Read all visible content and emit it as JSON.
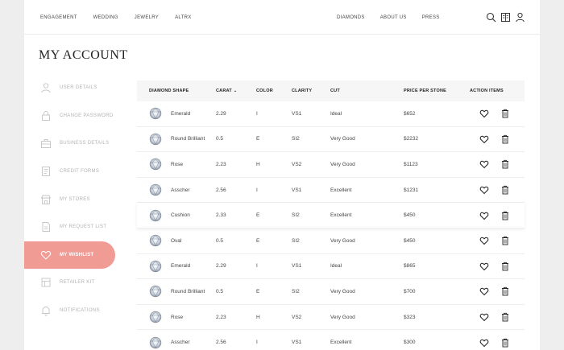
{
  "nav": {
    "left": [
      "ENGAGEMENT",
      "WEDDING",
      "JEWELRY",
      "ALTRX"
    ],
    "right": [
      "DIAMONDS",
      "ABOUT US",
      "PRESS"
    ],
    "icons": [
      "search-icon",
      "catalog-icon",
      "user-icon"
    ]
  },
  "page_title": "MY ACCOUNT",
  "sidebar": {
    "items": [
      {
        "label": "USER DETAILS",
        "icon": "user-icon"
      },
      {
        "label": "CHANGE PASSWORD",
        "icon": "lock-icon"
      },
      {
        "label": "BUSINESS DETAILS",
        "icon": "briefcase-icon"
      },
      {
        "label": "CREDIT FORMS",
        "icon": "form-icon"
      },
      {
        "label": "MY STORES",
        "icon": "store-icon"
      },
      {
        "label": "MY REQUEST LIST",
        "icon": "list-icon"
      },
      {
        "label": "MY WISHLIST",
        "icon": "heart-icon",
        "active": true
      },
      {
        "label": "RETAILER KIT",
        "icon": "kit-icon"
      },
      {
        "label": "NOTIFICATIONS",
        "icon": "bell-icon"
      }
    ]
  },
  "table": {
    "headers": {
      "shape": "DIAMOND SHAPE",
      "carat": "CARAT",
      "color": "COLOR",
      "clarity": "CLARITY",
      "cut": "CUT",
      "price": "PRICE PER STONE",
      "actions": "ACTION ITEMS"
    },
    "sort_indicator": "⌄",
    "rows": [
      {
        "shape": "Emerald",
        "carat": "2.29",
        "color": "I",
        "clarity": "VS1",
        "cut": "Ideal",
        "price": "$652"
      },
      {
        "shape": "Round Brilliant",
        "carat": "0.5",
        "color": "E",
        "clarity": "SI2",
        "cut": "Very Good",
        "price": "$2232"
      },
      {
        "shape": "Rose",
        "carat": "2.23",
        "color": "H",
        "clarity": "VS2",
        "cut": "Very Good",
        "price": "$1123"
      },
      {
        "shape": "Asscher",
        "carat": "2.56",
        "color": "I",
        "clarity": "VS1",
        "cut": "Excellent",
        "price": "$1231"
      },
      {
        "shape": "Cushion",
        "carat": "2.33",
        "color": "E",
        "clarity": "SI2",
        "cut": "Excellent",
        "price": "$450"
      },
      {
        "shape": "Oval",
        "carat": "0.5",
        "color": "E",
        "clarity": "SI2",
        "cut": "Very Good",
        "price": "$450"
      },
      {
        "shape": "Emerald",
        "carat": "2.29",
        "color": "I",
        "clarity": "VS1",
        "cut": "Ideal",
        "price": "$865"
      },
      {
        "shape": "Round Brilliant",
        "carat": "0.5",
        "color": "E",
        "clarity": "SI2",
        "cut": "Very Good",
        "price": "$700"
      },
      {
        "shape": "Rose",
        "carat": "2.23",
        "color": "H",
        "clarity": "VS2",
        "cut": "Very Good",
        "price": "$323"
      },
      {
        "shape": "Asscher",
        "carat": "2.56",
        "color": "I",
        "clarity": "VS1",
        "cut": "Excellent",
        "price": "$300"
      }
    ]
  },
  "colors": {
    "accent": "#f19b95",
    "background": "#eeeeee",
    "header_bg": "#f6f6f6"
  }
}
